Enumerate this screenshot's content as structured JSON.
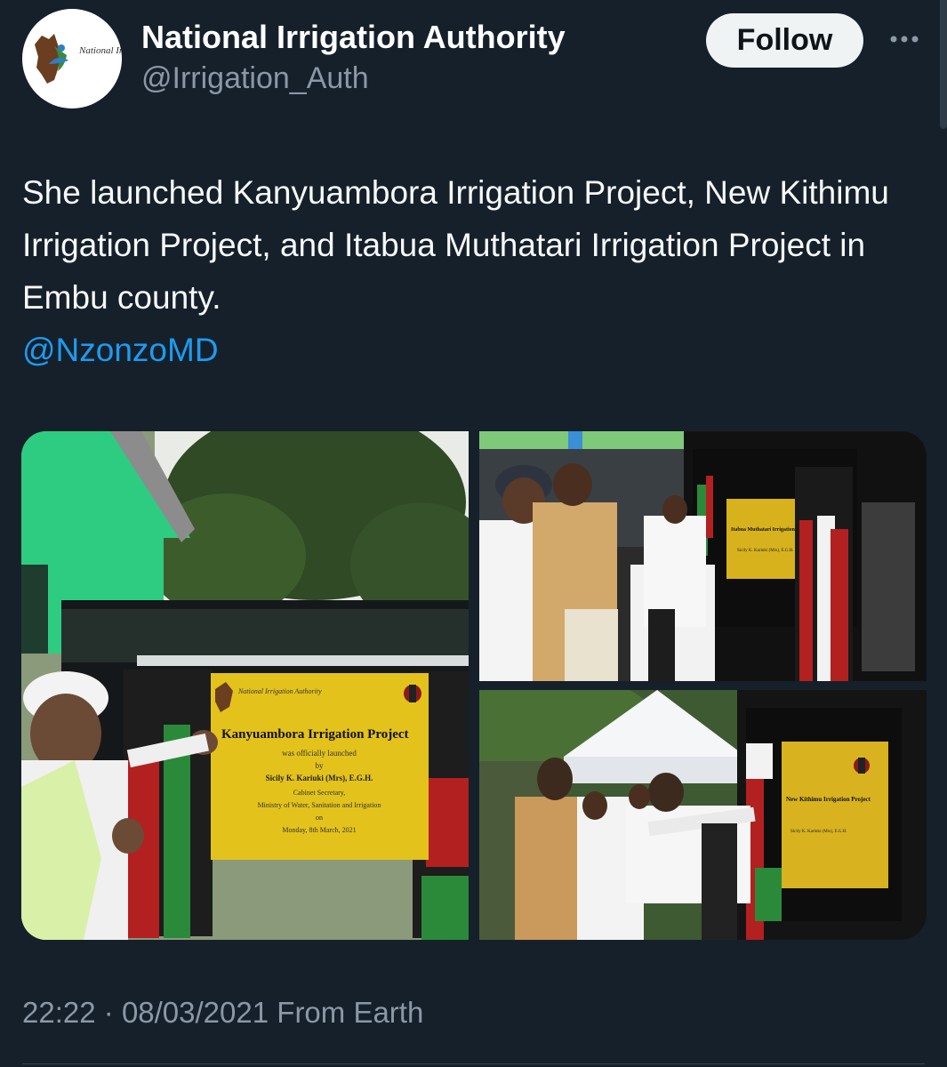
{
  "author": {
    "display_name": "National Irrigation Authority",
    "handle": "@Irrigation_Auth",
    "avatar_logo_text": "National Irrigation Authority"
  },
  "actions": {
    "follow_label": "Follow",
    "more_icon": "more-horizontal-icon"
  },
  "tweet": {
    "text": "She launched Kanyuambora Irrigation Project, New Kithimu Irrigation Project, and Itabua Muthatari Irrigation Project in Embu county.",
    "mention": "@NzonzoMD"
  },
  "media": {
    "photo_1": {
      "plaque_logo": "National Irrigation Authority",
      "plaque_title": "Kanyuambora Irrigation Project",
      "plaque_line1": "was officially launched",
      "plaque_line2": "by",
      "plaque_name": "Sicily K. Kariuki (Mrs), E.G.H.",
      "plaque_role": "Cabinet Secretary,",
      "plaque_ministry": "Ministry of Water, Sanitation and Irrigation",
      "plaque_on": "on",
      "plaque_date": "Monday, 8th March, 2021"
    },
    "photo_2": {
      "plaque_title": "Itabua Muthatari Irrigation Pr",
      "plaque_name": "Sicily K. Kariuki (Mrs), E.G.H."
    },
    "photo_3": {
      "plaque_title": "New Kithimu Irrigation Project",
      "plaque_name": "Sicily K. Kariuki (Mrs), E.G.H."
    }
  },
  "meta": {
    "time": "22:22",
    "separator": "·",
    "date": "08/03/2021",
    "source": "From Earth"
  }
}
